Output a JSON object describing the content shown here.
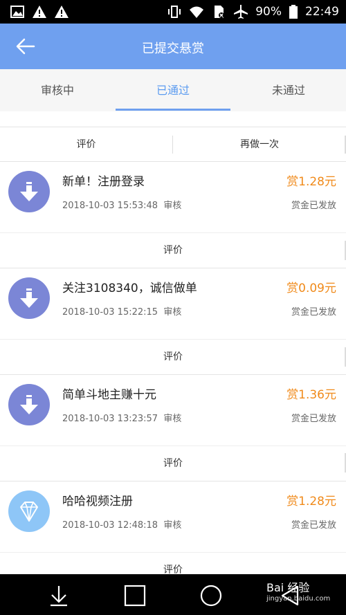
{
  "status_bar": {
    "battery": "90%",
    "time": "22:49",
    "icons_left": [
      "image-icon",
      "warning-icon",
      "warning-icon"
    ],
    "icons_right": [
      "vibrate-icon",
      "wifi-icon",
      "sim-icon",
      "airplane-icon",
      "battery-icon"
    ]
  },
  "header": {
    "title": "已提交悬赏",
    "back_icon": "arrow-left-icon"
  },
  "tabs": [
    {
      "label": "审核中",
      "active": false
    },
    {
      "label": "已通过",
      "active": true
    },
    {
      "label": "未通过",
      "active": false
    }
  ],
  "top_actions": {
    "evaluate": "评价",
    "redo": "再做一次"
  },
  "items": [
    {
      "icon": "download-icon",
      "name": "新单！注册登录",
      "reward": "赏1.28元",
      "date": "2018-10-03 15:53:48",
      "review": "审核",
      "status": "赏金已发放",
      "evaluate": "评价"
    },
    {
      "icon": "download-icon",
      "name": "关注3108340，诚信做单",
      "reward": "赏0.09元",
      "date": "2018-10-03 15:22:15",
      "review": "审核",
      "status": "赏金已发放",
      "evaluate": "评价"
    },
    {
      "icon": "download-icon",
      "name": "简单斗地主赚十元",
      "reward": "赏1.36元",
      "date": "2018-10-03 13:23:57",
      "review": "审核",
      "status": "赏金已发放",
      "evaluate": "评价"
    },
    {
      "icon": "diamond-icon",
      "name": "哈哈视频注册",
      "reward": "赏1.28元",
      "date": "2018-10-03 12:48:18",
      "review": "审核",
      "status": "赏金已发放",
      "evaluate": "评价"
    }
  ],
  "nav_bar": {
    "buttons": [
      "download-icon",
      "square-icon",
      "circle-icon",
      "triangle-icon"
    ]
  },
  "watermark": {
    "brand": "Bai 经验",
    "url": "jingyan.baidu.com"
  },
  "colors": {
    "header_bg": "#6fa0ef",
    "tab_active": "#5b9bf0",
    "reward": "#f08a1a",
    "icon_purple": "#7b86d6",
    "icon_lightblue": "#8ec6f7"
  }
}
